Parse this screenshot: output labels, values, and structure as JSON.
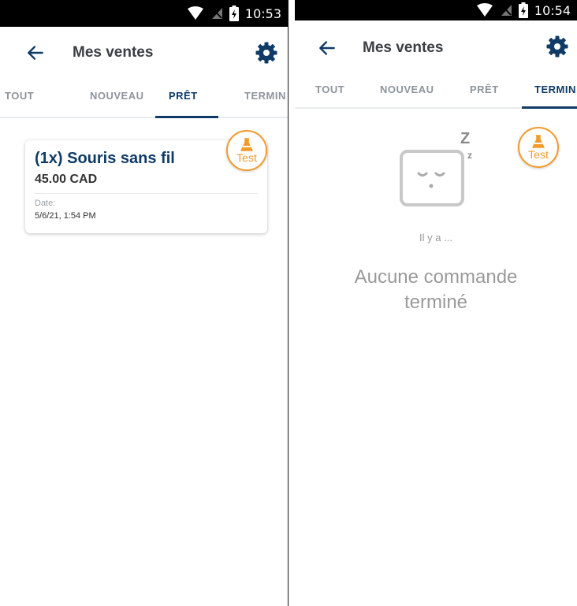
{
  "colors": {
    "primary": "#0f3b66",
    "accent_orange": "#f29b2b",
    "muted": "#9a9a9a",
    "statusbar_bg": "#000000"
  },
  "left_screen": {
    "status_time": "10:53",
    "header": {
      "title": "Mes ventes",
      "back_icon": "arrow-left-icon",
      "settings_icon": "gear-icon"
    },
    "tabs": [
      {
        "label": "TOUT",
        "active": false
      },
      {
        "label": "NOUVEAU",
        "active": false
      },
      {
        "label": "PRÊT",
        "active": true
      },
      {
        "label": "TERMIN",
        "active": false
      }
    ],
    "order_card": {
      "title": "(1x) Souris sans fil",
      "price": "45.00 CAD",
      "date_label": "Date:",
      "date": "5/6/21, 1:54 PM"
    },
    "test_badge": {
      "label": "Test",
      "icon": "flask-icon"
    }
  },
  "right_screen": {
    "status_time": "10:54",
    "header": {
      "title": "Mes ventes",
      "back_icon": "arrow-left-icon",
      "settings_icon": "gear-icon"
    },
    "tabs": [
      {
        "label": "TOUT",
        "active": false
      },
      {
        "label": "NOUVEAU",
        "active": false
      },
      {
        "label": "PRÊT",
        "active": false
      },
      {
        "label": "TERMIN",
        "active": true
      }
    ],
    "empty_state": {
      "z_big": "Z",
      "z_small": "z",
      "subtitle": "Il y a ...",
      "message_line1": "Aucune commande",
      "message_line2": "terminé",
      "icon": "sleeping-face-icon"
    },
    "test_badge": {
      "label": "Test",
      "icon": "flask-icon"
    }
  }
}
